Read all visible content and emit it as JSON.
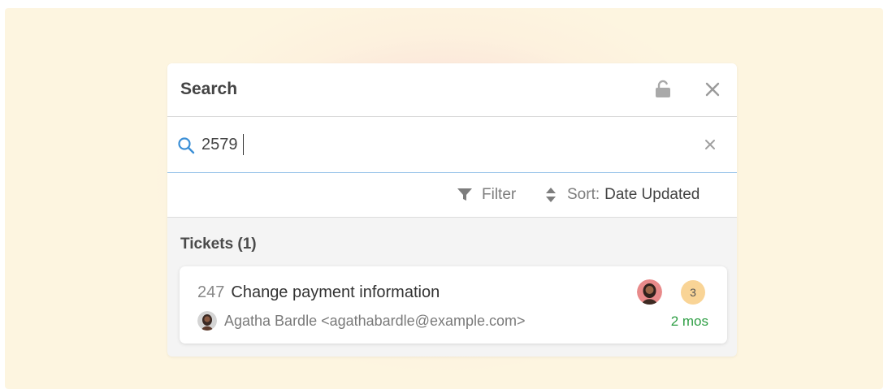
{
  "panel": {
    "title": "Search"
  },
  "search": {
    "query": "2579",
    "placeholder": ""
  },
  "toolbar": {
    "filter_label": "Filter",
    "sort_label": "Sort:",
    "sort_value": "Date Updated"
  },
  "results": {
    "section_title": "Tickets (1)",
    "tickets": [
      {
        "id": "247",
        "subject": "Change payment information",
        "requester": "Agatha Bardle <agathabardle@example.com>",
        "message_count": "3",
        "age": "2 mos"
      }
    ]
  },
  "colors": {
    "accent": "#3b8fd6",
    "age_green": "#2e9e44",
    "badge": "#f9d496",
    "backdrop": "#fdf3dd"
  },
  "icons": [
    "lock-open-icon",
    "close-icon",
    "search-icon",
    "clear-icon",
    "filter-icon",
    "sort-icon"
  ]
}
